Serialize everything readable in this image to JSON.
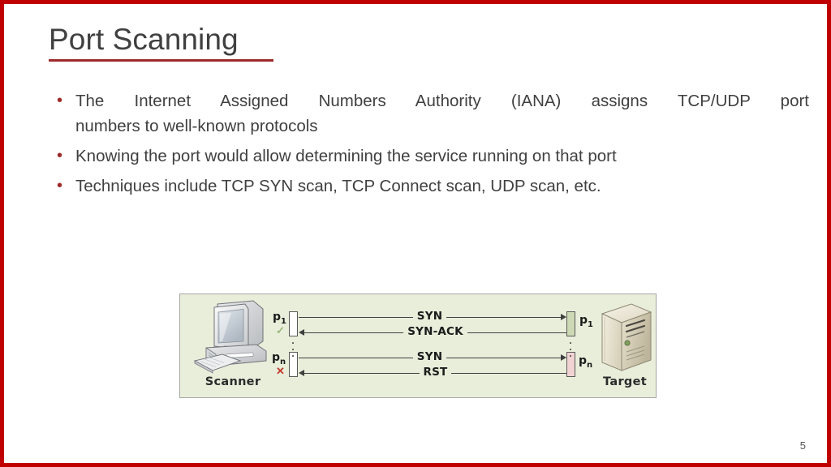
{
  "slide": {
    "title": "Port Scanning",
    "number": "5",
    "accent_color": "#9e2a2a",
    "border_color": "#c00000",
    "text_color": "#404040"
  },
  "bullets": [
    {
      "marker": "•",
      "line1": "The Internet Assigned Numbers Authority (IANA) assigns TCP/UDP port",
      "line2": "numbers to well-known protocols"
    },
    {
      "marker": "•",
      "text": "Knowing the port would allow determining the service running on that port"
    },
    {
      "marker": "•",
      "text": "Techniques include TCP SYN scan, TCP Connect scan, UDP scan, etc."
    }
  ],
  "diagram": {
    "background_color": "#e9eedb",
    "border_color": "#a6a6a6",
    "scanner_label": "Scanner",
    "target_label": "Target",
    "scanner_ports": [
      {
        "name": "p",
        "index": "1",
        "status_mark": "✓",
        "status_color": "#9cb87a",
        "state": "open"
      },
      {
        "name": "p",
        "index": "n",
        "status_mark": "✕",
        "status_color": "#c0392b",
        "state": "closed"
      }
    ],
    "target_ports": [
      {
        "name": "p",
        "index": "1",
        "state": "open",
        "color": "#cdd9b4"
      },
      {
        "name": "p",
        "index": "n",
        "state": "closed",
        "color": "#f2d3d3"
      }
    ],
    "ellipsis": "⋮",
    "messages": [
      {
        "label": "SYN",
        "direction": "right"
      },
      {
        "label": "SYN-ACK",
        "direction": "left"
      },
      {
        "label": "SYN",
        "direction": "right"
      },
      {
        "label": "RST",
        "direction": "left"
      }
    ]
  }
}
